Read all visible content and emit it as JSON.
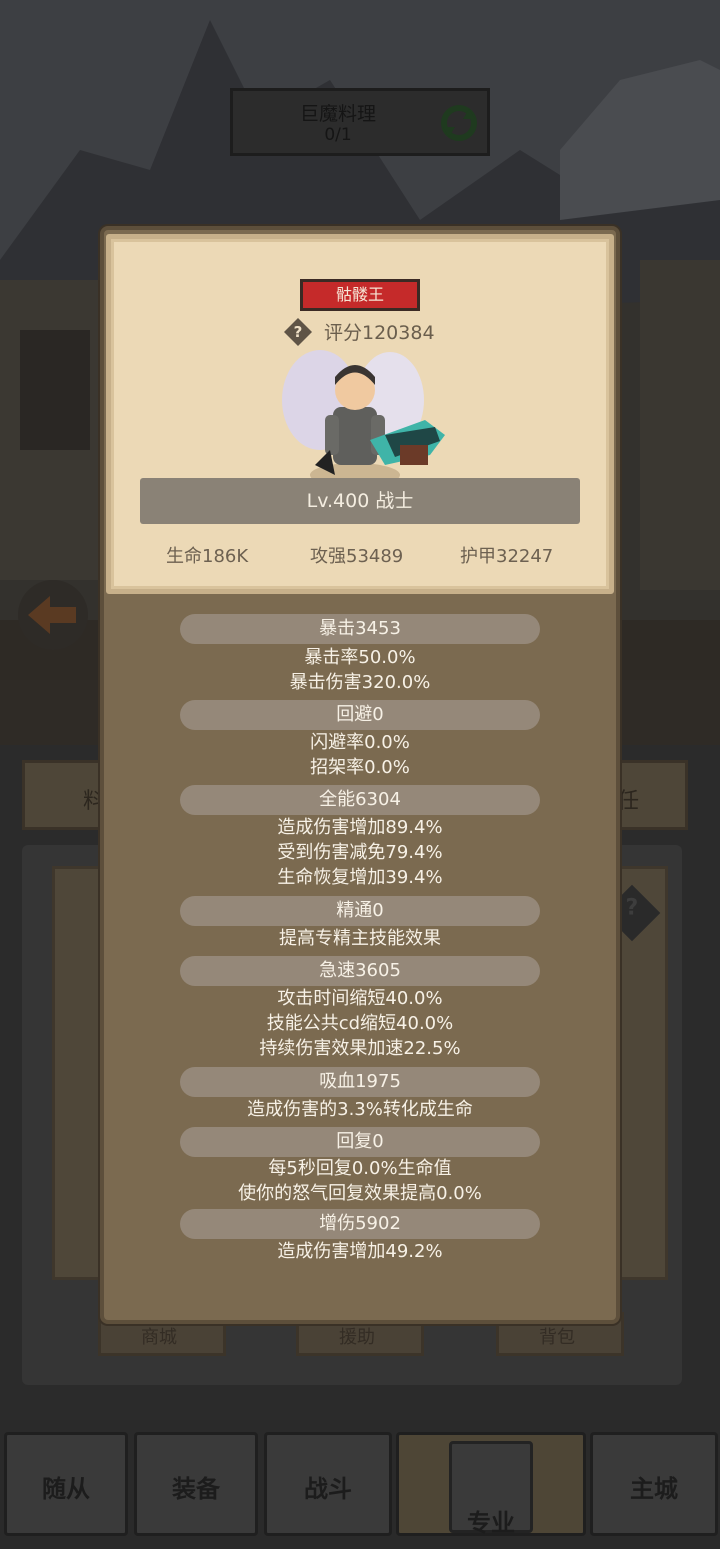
{
  "background": {
    "top_banner": {
      "title": "巨魔料理",
      "progress": "0/1"
    },
    "tabs": [
      "料",
      "任"
    ],
    "ghost_buttons": [
      "商城",
      "援助",
      "背包"
    ]
  },
  "hero_card": {
    "name": "骷髅王",
    "score_icon": "?",
    "score": "评分120384",
    "level_class": "Lv.400 战士",
    "hp": "生命186K",
    "attack": "攻强53489",
    "armor": "护甲32247"
  },
  "stats": [
    {
      "header": "暴击3453",
      "lines": [
        "暴击率50.0%",
        "暴击伤害320.0%"
      ]
    },
    {
      "header": "回避0",
      "lines": [
        "闪避率0.0%",
        "招架率0.0%"
      ]
    },
    {
      "header": "全能6304",
      "lines": [
        "造成伤害增加89.4%",
        "受到伤害减免79.4%",
        "生命恢复增加39.4%"
      ]
    },
    {
      "header": "精通0",
      "lines": [
        "提高专精主技能效果"
      ]
    },
    {
      "header": "急速3605",
      "lines": [
        "攻击时间缩短40.0%",
        "技能公共cd缩短40.0%",
        "持续伤害效果加速22.5%"
      ]
    },
    {
      "header": "吸血1975",
      "lines": [
        "造成伤害的3.3%转化成生命"
      ]
    },
    {
      "header": "回复0",
      "lines": [
        "每5秒回复0.0%生命值",
        "使你的怒气回复效果提高0.0%"
      ]
    },
    {
      "header": "增伤5902",
      "lines": [
        "造成伤害增加49.2%"
      ]
    }
  ],
  "bottom_nav": {
    "items": [
      "随从",
      "装备",
      "战斗",
      "专业",
      "主城"
    ],
    "active": "专业"
  },
  "colors": {
    "name_tag": "#c52a2a",
    "popup_body": "#7b6a50",
    "card_paper": "#ecd9b6",
    "stat_header": "#958879"
  },
  "icons": [
    "help-icon",
    "refresh-icon",
    "back-arrow-icon",
    "hero-portrait-icon"
  ]
}
